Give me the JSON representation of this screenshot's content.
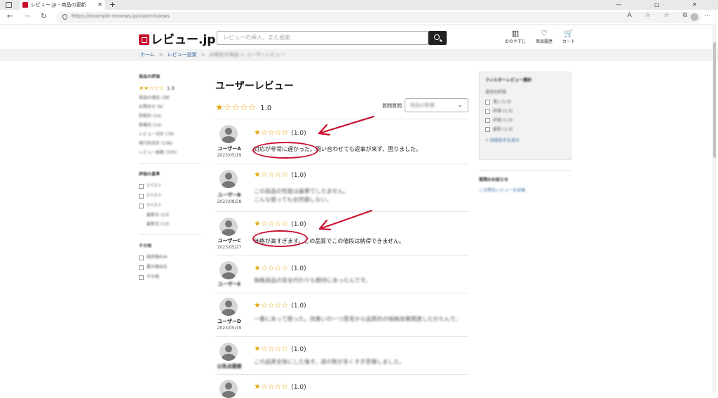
{
  "browser": {
    "tab_title": "レビュー.jp - 商品の更新",
    "url": "https://example-reviews.jp/user/reviews",
    "window_controls": "— ▢ ✕"
  },
  "header": {
    "logo_text": "レビュー.jp",
    "search_placeholder": "レビューの挿入、また検索",
    "icons": [
      {
        "label": "おのやすじ",
        "icon": "store-icon",
        "glyph": "▥"
      },
      {
        "label": "商品履歴",
        "icon": "heart-icon",
        "glyph": "♡"
      },
      {
        "label": "カート",
        "icon": "cart-icon",
        "glyph": "🛒"
      }
    ]
  },
  "breadcrumb": {
    "home": "ホーム",
    "second": "レビュー提案",
    "third": "お問合せ商品 > ユーザーレビュー"
  },
  "left_sidebar": {
    "section1_title": "商品の評価",
    "rating_stars": "★★☆☆☆",
    "rating_value": "1.0",
    "items": [
      "商品の満足 (38)",
      "お問合せ (9)",
      "回答的 (24)",
      "新着的 (14)",
      "レビュー合計 (79)",
      "発行的合計 (138)",
      "レビュー総数 (335)"
    ],
    "section2_title": "評価の基準",
    "section2_items": [
      "1ベスト",
      "2ベスト",
      "3ベスト",
      "最新日 (13)",
      "最新日 (13)"
    ],
    "section3_title": "その他",
    "section3_items": [
      "高評価のみ",
      "要の検出を",
      "その他"
    ]
  },
  "main": {
    "title": "ユーザーレビュー",
    "summary_stars": "★☆☆☆☆",
    "summary_score": "1.0",
    "sort_label": "質問質問",
    "sort_value": "商品の新着",
    "reviews": [
      {
        "user": "ユーザーA",
        "date": "2023/05/19",
        "stars": "★☆☆☆☆",
        "score": "(1.0)",
        "text": "対応が非常に遅かった。問い合わせても返事が来ず、困りました。"
      },
      {
        "user": "ユーザーB",
        "date": "2023/08/28",
        "stars": "★☆☆☆☆",
        "score": "(1.0)",
        "text": "この商品の性能は最悪でしたません。\nこんな使っても全然値しない。"
      },
      {
        "user": "ユーザーC",
        "date": "2023/05/27",
        "stars": "★☆☆☆☆",
        "score": "(1.0)",
        "text": "価格が高すぎます。この品質でこの値段は納得できません。"
      },
      {
        "user": "ユーザーE",
        "date": "",
        "stars": "★☆☆☆☆",
        "score": "(1.0)",
        "text": "価格商品の安全代わりも期待にあったんです。"
      },
      {
        "user": "ユーザーD",
        "date": "2023/05/19",
        "stars": "★☆☆☆☆",
        "score": "(1.0)",
        "text": "一番にあって困った。改善いの一つ意見から品質的の価格改善関連したかたんで。"
      },
      {
        "user": "公告点感想",
        "date": "",
        "stars": "★☆☆☆☆",
        "score": "(1.0)",
        "text": "この品質全体にした後す。違の数が多くすぎ苦情しました。"
      },
      {
        "user": "",
        "date": "",
        "stars": "★☆☆☆☆",
        "score": "(1.0)",
        "text": ""
      }
    ]
  },
  "right_sidebar": {
    "filter_title": "フィルターレビュー選択",
    "filter_sub": "過去的評価",
    "filter_items": [
      "青1 (1.0)",
      "評価 (1.0)",
      "評価 (1.0)",
      "最新 (1.0)"
    ],
    "filter_link": "+ 詳細条件を表示",
    "notice_title": "質問のお知らせ",
    "notice_link": "この問合レビューを詳細"
  },
  "colors": {
    "brand": "#c8102e",
    "star": "#e6a817",
    "annotation": "#c8102e",
    "link": "#3a6ea5"
  }
}
